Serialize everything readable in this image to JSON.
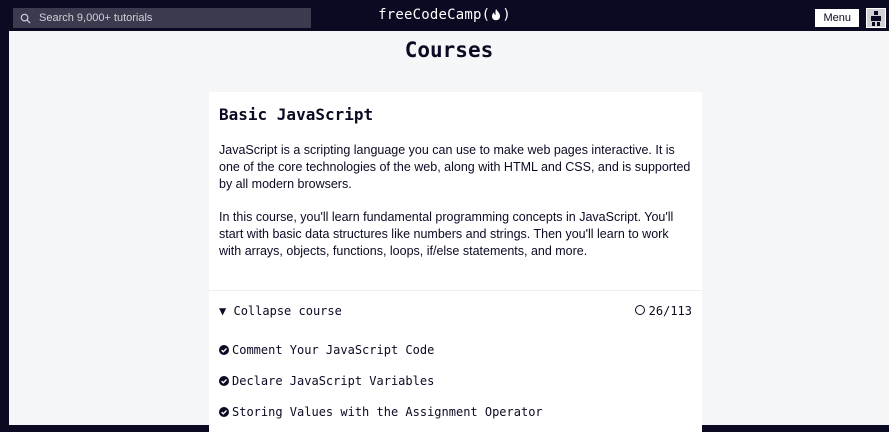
{
  "navbar": {
    "search_placeholder": "Search 9,000+ tutorials",
    "brand": "freeCodeCamp",
    "menu_label": "Menu"
  },
  "page": {
    "title": "Courses"
  },
  "course": {
    "title": "Basic JavaScript",
    "description": [
      "JavaScript is a scripting language you can use to make web pages interactive. It is one of the core technologies of the web, along with HTML and CSS, and is supported by all modern browsers.",
      "In this course, you'll learn fundamental programming concepts in JavaScript. You'll start with basic data structures like numbers and strings. Then you'll learn to work with arrays, objects, functions, loops, if/else statements, and more."
    ],
    "collapse_label": "Collapse course",
    "progress": "26/113",
    "lessons": [
      "Comment Your JavaScript Code",
      "Declare JavaScript Variables",
      "Storing Values with the Assignment Operator"
    ]
  },
  "colors": {
    "nav_bg": "#0a0a23",
    "page_bg": "#f5f6f7",
    "card_bg": "#ffffff",
    "text": "#0a0a23"
  }
}
